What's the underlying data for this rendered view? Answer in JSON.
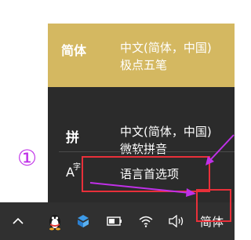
{
  "ime_menu": {
    "items": [
      {
        "code": "简体",
        "language": "中文(简体，中国)",
        "method": "极点五笔",
        "active": true
      },
      {
        "code_icon": "pinyin-icon",
        "code": "拼",
        "language": "中文(简体，中国)",
        "method": "微软拼音",
        "active": false
      }
    ],
    "language_preferences": {
      "icon": "language-preferences-icon",
      "label": "语言首选项"
    }
  },
  "annotation": {
    "step_marker": "①"
  },
  "taskbar": {
    "icons": [
      "chevron-up-icon",
      "qq-penguin-icon",
      "dropbox-icon",
      "battery-icon",
      "wifi-icon",
      "volume-icon"
    ],
    "ime_indicator": "简体"
  },
  "colors": {
    "active_row": "#d4b861",
    "panel": "#2b2b2b",
    "taskbar": "#303030",
    "highlight_red": "#e8303a",
    "annotation_purple": "#c030e8"
  }
}
